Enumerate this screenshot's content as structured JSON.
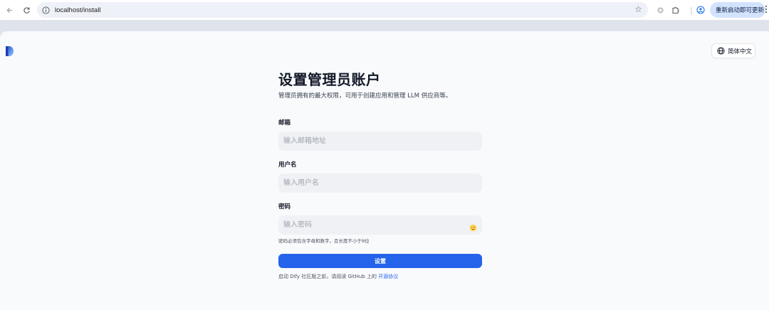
{
  "browser": {
    "url": "localhost/install",
    "update_button": "重新启动即可更新"
  },
  "header": {
    "language_button": "简体中文"
  },
  "form": {
    "title": "设置管理员账户",
    "subtitle": "管理员拥有的最大权限，可用于创建应用和管理 LLM 供应商等。",
    "email_label": "邮箱",
    "email_placeholder": "输入邮箱地址",
    "username_label": "用户名",
    "username_placeholder": "输入用户名",
    "password_label": "密码",
    "password_placeholder": "输入密码",
    "password_hint": "密码必须包含字母和数字，且长度不小于8位",
    "submit_label": "设置",
    "agreement_prefix": "启动 Dify 社区版之前，请阅读 GitHub 上的 ",
    "agreement_link": "开源协议"
  },
  "colors": {
    "primary": "#2563eb",
    "page_bg": "#f9fafb",
    "input_bg": "#f0f1f4"
  },
  "icons": [
    "back-icon",
    "reload-icon",
    "site-info-icon",
    "star-icon",
    "extension-icon",
    "puzzle-icon",
    "profile-icon",
    "menu-icon",
    "dify-logo",
    "globe-icon",
    "eye-icon"
  ]
}
